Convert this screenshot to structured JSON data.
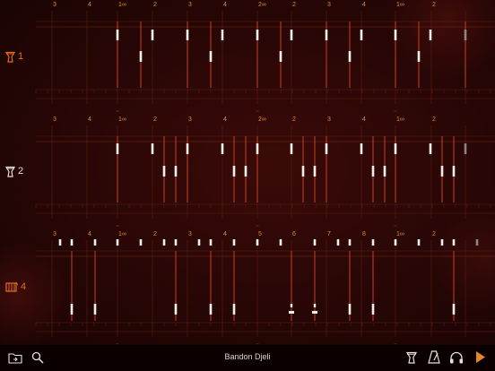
{
  "app": {
    "song_title": "Bandon Djeli"
  },
  "colors": {
    "accent": "#e0892a",
    "grid_dim": "#5a1f14",
    "grid_mid": "#7a2c18",
    "marker": "#c9401d",
    "note": "#f2efe9",
    "note_dim": "#8c8781",
    "label_active": "#e46b20",
    "label_inactive": "#e8e2da"
  },
  "ruler_labels": [
    "3",
    "4",
    "1∞",
    "2",
    "3",
    "4",
    "2∞",
    "2",
    "3",
    "4",
    "1∞",
    "2"
  ],
  "ruler_labels_track3": [
    "3",
    "4",
    "1∞",
    "2",
    "3",
    "4",
    "5",
    "6",
    "7",
    "8",
    "1∞",
    "2"
  ],
  "tracks": [
    {
      "number": "1",
      "icon": "djembe-icon",
      "active": true
    },
    {
      "number": "2",
      "icon": "djembe-icon",
      "active": false
    },
    {
      "number": "4",
      "icon": "dundun-icon",
      "active": true
    }
  ],
  "toolbar": {
    "left": [
      "folder-icon",
      "search-icon"
    ],
    "right": [
      "djembe-icon",
      "metronome-icon",
      "headphones-icon",
      "play-icon"
    ]
  }
}
